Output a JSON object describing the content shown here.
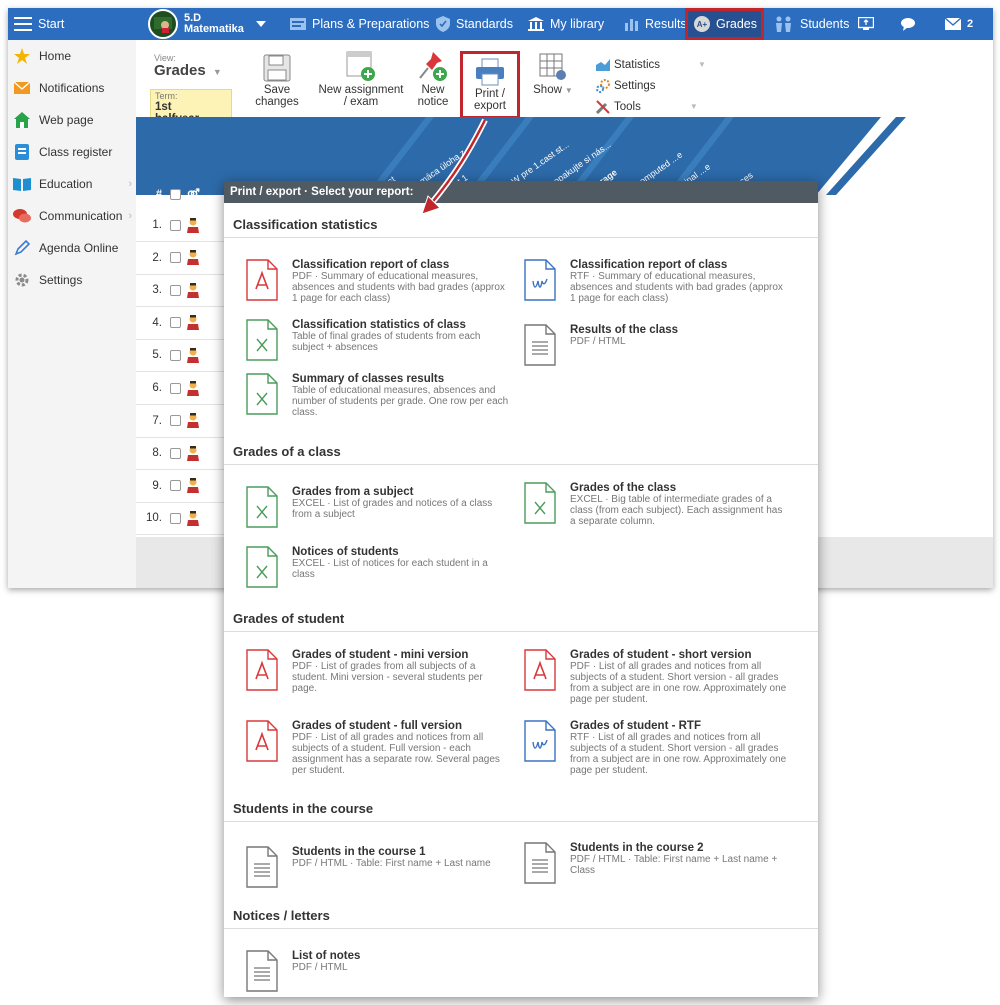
{
  "topbar": {
    "start": "Start",
    "class_name": "5.D",
    "subject": "Matematika",
    "plans": "Plans & Preparations",
    "standards": "Standards",
    "library": "My library",
    "results": "Results",
    "grades": "Grades",
    "students": "Students",
    "mail_count": "2"
  },
  "sidebar": {
    "items": [
      {
        "label": "Home",
        "icon": "star-icon"
      },
      {
        "label": "Notifications",
        "icon": "envelope-icon"
      },
      {
        "label": "Web page",
        "icon": "house-icon"
      },
      {
        "label": "Class register",
        "icon": "register-icon"
      },
      {
        "label": "Education",
        "icon": "book-icon"
      },
      {
        "label": "Communication",
        "icon": "chat-icon"
      },
      {
        "label": "Agenda Online",
        "icon": "pen-icon"
      },
      {
        "label": "Settings",
        "icon": "gear-icon"
      }
    ]
  },
  "ribbon": {
    "view_label": "View:",
    "view_value": "Grades",
    "term_label": "Term:",
    "term_value": "1st halfyear",
    "save": "Save changes",
    "new_assignment": "New assignment / exam",
    "new_notice": "New notice",
    "print_export": "Print / export",
    "show": "Show",
    "menu": [
      "Statistics",
      "Settings",
      "Tools"
    ]
  },
  "grid": {
    "col_number": "#",
    "col_gender": "⚤",
    "rows": [
      "1.",
      "2.",
      "3.",
      "4.",
      "5.",
      "6.",
      "7.",
      "8.",
      "9.",
      "10."
    ],
    "column_headers": [
      "...st",
      "...máca úloha z...",
      "...t 1",
      "...W pre 1.cast st...",
      "...opakujte si nás...",
      "...rage",
      "...omputed ...e",
      "...inal ...e",
      "...ces"
    ]
  },
  "popup": {
    "title": "Print / export · Select your report:",
    "sections": [
      {
        "title": "Classification statistics",
        "reports": [
          {
            "title": "Classification report of class",
            "desc": "PDF · Summary of educational measures, absences and students with bad grades (approx 1 page for each class)",
            "icon": "pdf"
          },
          {
            "title": "Classification report of class",
            "desc": "RTF · Summary of educational measures, absences and students with bad grades (approx 1 page for each class)",
            "icon": "rtf"
          },
          {
            "title": "Classification statistics of class",
            "desc": "Table of final grades of students from each subject + absences",
            "icon": "excel"
          },
          {
            "title": "Results of the class",
            "desc": "PDF / HTML",
            "icon": "doc"
          },
          {
            "title": "Summary of classes results",
            "desc": "Table of educational measures, absences and number of students per grade. One row per each class.",
            "icon": "excel"
          }
        ]
      },
      {
        "title": "Grades of a class",
        "reports": [
          {
            "title": "Grades from a subject",
            "desc": "EXCEL · List of grades and notices of a class from a subject",
            "icon": "excel"
          },
          {
            "title": "Grades of the class",
            "desc": "EXCEL · Big table of intermediate grades of a class (from each subject). Each assignment has a separate column.",
            "icon": "excel"
          },
          {
            "title": "Notices of students",
            "desc": "EXCEL · List of notices for each student in a class",
            "icon": "excel"
          }
        ]
      },
      {
        "title": "Grades of student",
        "reports": [
          {
            "title": "Grades of student - mini version",
            "desc": "PDF · List of grades from all subjects of a student. Mini version - several students per page.",
            "icon": "pdf"
          },
          {
            "title": "Grades of student - short version",
            "desc": "PDF · List of all grades and notices from all subjects of a student. Short version - all grades from a subject are in one row. Approximately one page per student.",
            "icon": "pdf"
          },
          {
            "title": "Grades of student - full version",
            "desc": "PDF · List of all grades and notices from all subjects of a student. Full version - each assignment has a separate row. Several pages per student.",
            "icon": "pdf"
          },
          {
            "title": "Grades of student - RTF",
            "desc": "RTF · List of all grades and notices from all subjects of a student. Short version - all grades from a subject are in one row. Approximately one page per student.",
            "icon": "rtf"
          }
        ]
      },
      {
        "title": "Students in the course",
        "reports": [
          {
            "title": "Students in the course 1",
            "desc": "PDF / HTML · Table: First name + Last name",
            "icon": "doc"
          },
          {
            "title": "Students in the course 2",
            "desc": "PDF / HTML · Table: First name + Last name + Class",
            "icon": "doc"
          }
        ]
      },
      {
        "title": "Notices / letters",
        "reports": [
          {
            "title": "List of notes",
            "desc": "PDF / HTML",
            "icon": "doc"
          }
        ]
      }
    ]
  },
  "colors": {
    "topbar": "#2d6dbf",
    "highlight": "#c0262c",
    "banner": "#2d6aa9",
    "popup_header": "#4f5a62",
    "pdf": "#d9383a",
    "rtf": "#3a73c2",
    "excel": "#4a9d5b",
    "doc": "#777777"
  }
}
